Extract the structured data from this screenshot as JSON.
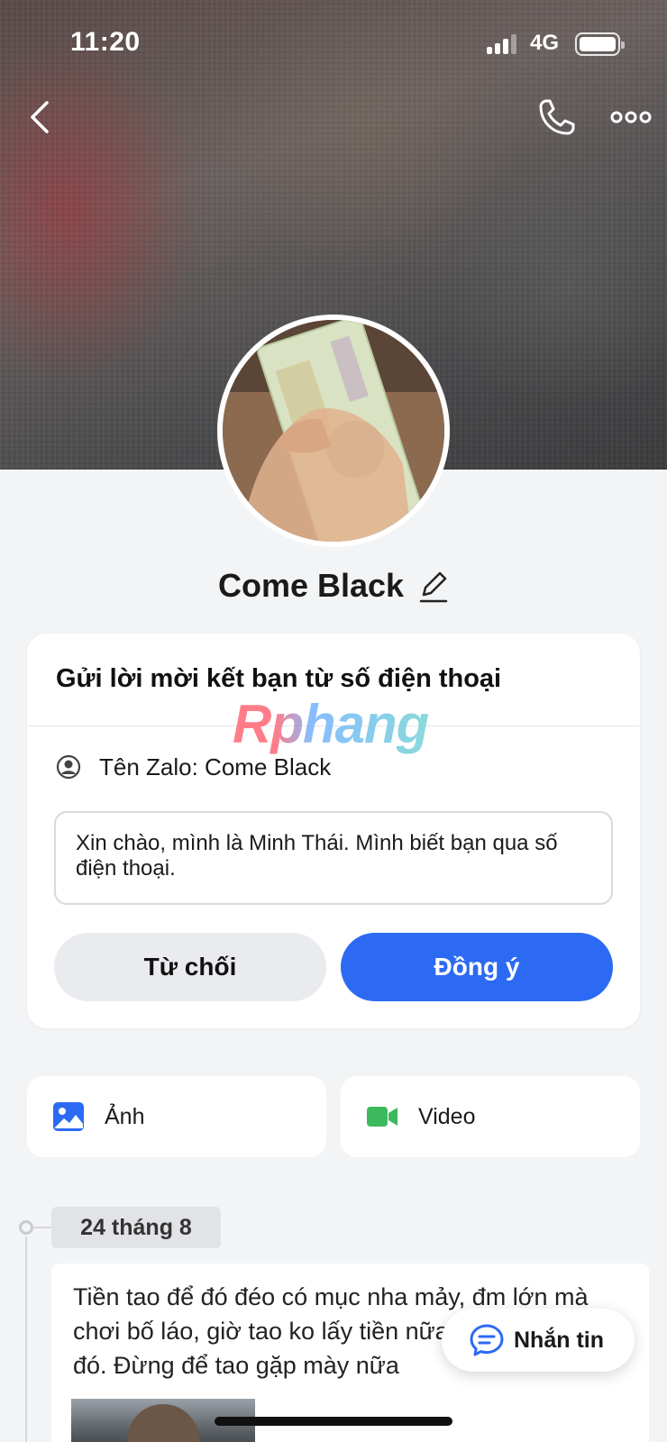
{
  "status_bar": {
    "time": "11:20",
    "network": "4G"
  },
  "profile": {
    "name": "Come Black"
  },
  "friend_request": {
    "title": "Gửi lời mời kết bạn từ số điện thoại",
    "zalo_name": "Tên Zalo: Come Black",
    "message": "Xin chào, mình là Minh Thái. Mình biết bạn qua số điện thoại.",
    "decline_label": "Từ chối",
    "accept_label": "Đồng ý"
  },
  "watermark": "Rphang",
  "media": {
    "photo_label": "Ảnh",
    "video_label": "Video"
  },
  "timeline": {
    "date": "24 tháng 8",
    "post_text": "Tiền tao để đó đéo có mục nha mảy, đm lớn mà chơi bố láo, giờ tao ko lấy tiền nữa cho mày lun đó. Đừng để tao gặp mày nữa"
  },
  "chat_button": {
    "label": "Nhắn tin"
  },
  "colors": {
    "accent": "#2d6af3",
    "photo_icon": "#2d6af3",
    "video_icon": "#3cb95c"
  },
  "icons": [
    "back-icon",
    "phone-icon",
    "more-icon",
    "edit-icon",
    "user-circle-icon",
    "image-icon",
    "video-camera-icon",
    "chat-bubble-icon"
  ]
}
